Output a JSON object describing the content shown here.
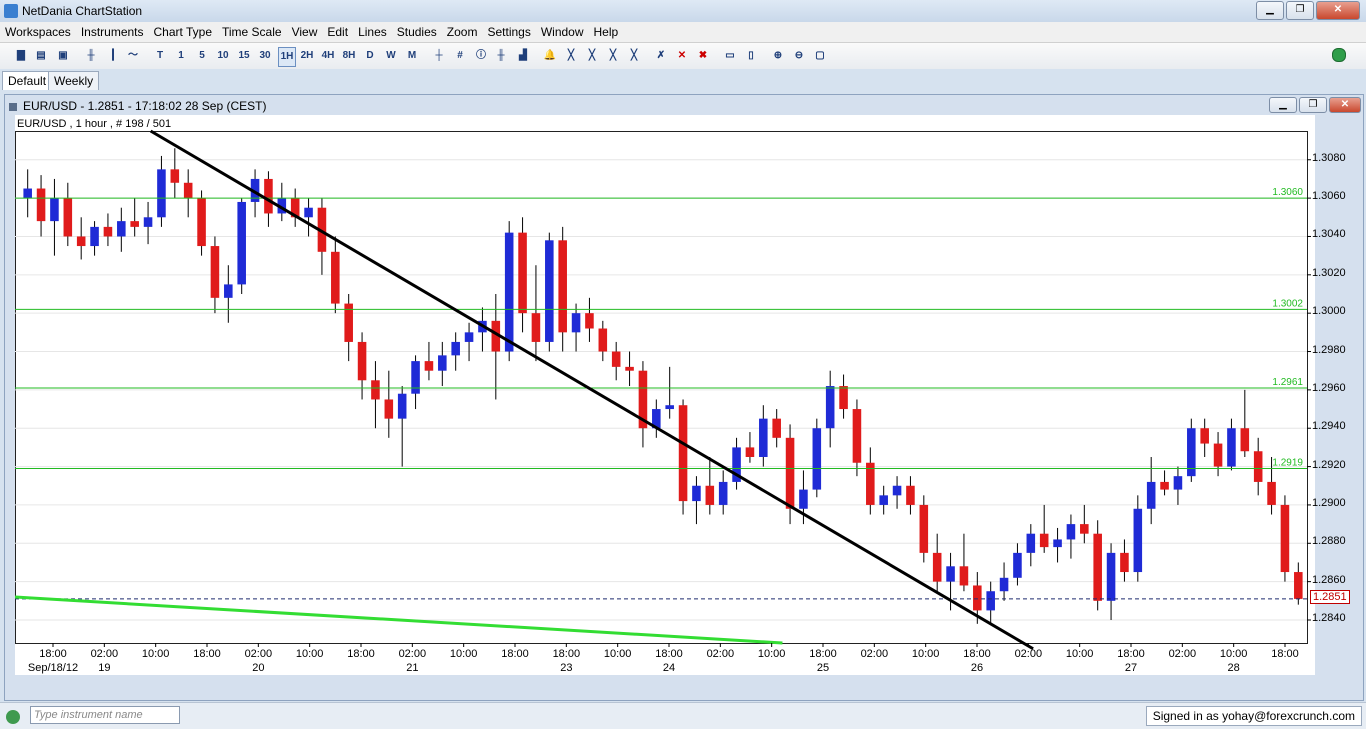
{
  "app": {
    "title": "NetDania ChartStation",
    "minimize": "▁",
    "maximize": "❐",
    "close": "✕"
  },
  "menu": [
    "Workspaces",
    "Instruments",
    "Chart Type",
    "Time Scale",
    "View",
    "Edit",
    "Lines",
    "Studies",
    "Zoom",
    "Settings",
    "Window",
    "Help"
  ],
  "toolbar": {
    "timeframes": [
      "T",
      "1",
      "5",
      "10",
      "15",
      "30",
      "1H",
      "2H",
      "4H",
      "8H",
      "D",
      "W",
      "M"
    ],
    "active_timeframe": "1H",
    "status_color": "#2f9e4a"
  },
  "tabs": [
    {
      "label": "Default",
      "active": true
    },
    {
      "label": "Weekly",
      "active": false
    }
  ],
  "chart_window": {
    "title": "EUR/USD - 1.2851 - 17:18:02  28 Sep (CEST)",
    "legend": "EUR/USD , 1 hour , # 198 / 501"
  },
  "chart_data": {
    "type": "candlestick",
    "instrument": "EUR/USD",
    "interval": "1 hour",
    "ylim": [
      1.2828,
      1.3095
    ],
    "y_ticks": [
      "1.3080",
      "1.3060",
      "1.3040",
      "1.3020",
      "1.3000",
      "1.2980",
      "1.2960",
      "1.2940",
      "1.2920",
      "1.2900",
      "1.2880",
      "1.2860",
      "1.2840"
    ],
    "y_tick_values": [
      1.308,
      1.306,
      1.304,
      1.302,
      1.3,
      1.298,
      1.296,
      1.294,
      1.292,
      1.29,
      1.288,
      1.286,
      1.284
    ],
    "x_time_labels": [
      "18:00",
      "02:00",
      "10:00",
      "18:00",
      "02:00",
      "10:00",
      "18:00",
      "02:00",
      "10:00",
      "18:00",
      "18:00",
      "10:00",
      "18:00",
      "02:00",
      "10:00",
      "18:00",
      "02:00",
      "10:00",
      "18:00",
      "02:00",
      "10:00",
      "18:00",
      "02:00",
      "10:00",
      "18:00"
    ],
    "x_date_labels": [
      "Sep/18/12",
      "19",
      "20",
      "21",
      "23",
      "24",
      "25",
      "26",
      "27",
      "28"
    ],
    "horizontal_lines": [
      {
        "label": "1.3060",
        "value": 1.306,
        "color": "#22bb22"
      },
      {
        "label": "1.3002",
        "value": 1.3002,
        "color": "#22bb22"
      },
      {
        "label": "1.2961",
        "value": 1.2961,
        "color": "#22bb22"
      },
      {
        "label": "1.2919",
        "value": 1.2919,
        "color": "#22bb22"
      }
    ],
    "current_price": {
      "label": "1.2851",
      "value": 1.2851,
      "color": "#c00000"
    },
    "trendlines": [
      {
        "color": "#000000",
        "from": [
          0.105,
          1.3095
        ],
        "to": [
          0.788,
          1.2825
        ]
      },
      {
        "color": "#33dd33",
        "from": [
          0.0,
          1.2852
        ],
        "to": [
          0.594,
          1.2828
        ]
      }
    ],
    "candles": [
      [
        1.306,
        1.3075,
        1.305,
        1.3065
      ],
      [
        1.3065,
        1.3072,
        1.304,
        1.3048
      ],
      [
        1.3048,
        1.307,
        1.303,
        1.306
      ],
      [
        1.306,
        1.3068,
        1.3035,
        1.304
      ],
      [
        1.304,
        1.305,
        1.3028,
        1.3035
      ],
      [
        1.3035,
        1.3048,
        1.303,
        1.3045
      ],
      [
        1.3045,
        1.3052,
        1.3035,
        1.304
      ],
      [
        1.304,
        1.3055,
        1.3032,
        1.3048
      ],
      [
        1.3048,
        1.306,
        1.304,
        1.3045
      ],
      [
        1.3045,
        1.3058,
        1.3036,
        1.305
      ],
      [
        1.305,
        1.3082,
        1.3045,
        1.3075
      ],
      [
        1.3075,
        1.3086,
        1.306,
        1.3068
      ],
      [
        1.3068,
        1.3075,
        1.305,
        1.306
      ],
      [
        1.306,
        1.3064,
        1.303,
        1.3035
      ],
      [
        1.3035,
        1.304,
        1.3,
        1.3008
      ],
      [
        1.3008,
        1.3025,
        1.2995,
        1.3015
      ],
      [
        1.3015,
        1.306,
        1.301,
        1.3058
      ],
      [
        1.3058,
        1.3075,
        1.305,
        1.307
      ],
      [
        1.307,
        1.3074,
        1.3045,
        1.3052
      ],
      [
        1.3052,
        1.3068,
        1.3048,
        1.306
      ],
      [
        1.306,
        1.3065,
        1.3045,
        1.305
      ],
      [
        1.305,
        1.306,
        1.304,
        1.3055
      ],
      [
        1.3055,
        1.306,
        1.302,
        1.3032
      ],
      [
        1.3032,
        1.304,
        1.3,
        1.3005
      ],
      [
        1.3005,
        1.301,
        1.2975,
        1.2985
      ],
      [
        1.2985,
        1.299,
        1.2955,
        1.2965
      ],
      [
        1.2965,
        1.2975,
        1.294,
        1.2955
      ],
      [
        1.2955,
        1.297,
        1.2935,
        1.2945
      ],
      [
        1.2945,
        1.2962,
        1.292,
        1.2958
      ],
      [
        1.2958,
        1.2978,
        1.295,
        1.2975
      ],
      [
        1.2975,
        1.2985,
        1.2965,
        1.297
      ],
      [
        1.297,
        1.2985,
        1.2962,
        1.2978
      ],
      [
        1.2978,
        1.299,
        1.297,
        1.2985
      ],
      [
        1.2985,
        1.2995,
        1.2975,
        1.299
      ],
      [
        1.299,
        1.3003,
        1.298,
        1.2996
      ],
      [
        1.2996,
        1.301,
        1.2955,
        1.298
      ],
      [
        1.298,
        1.3048,
        1.2975,
        1.3042
      ],
      [
        1.3042,
        1.305,
        1.299,
        1.3
      ],
      [
        1.3,
        1.3025,
        1.2975,
        1.2985
      ],
      [
        1.2985,
        1.3042,
        1.298,
        1.3038
      ],
      [
        1.3038,
        1.3045,
        1.298,
        1.299
      ],
      [
        1.299,
        1.3005,
        1.298,
        1.3
      ],
      [
        1.3,
        1.3008,
        1.2985,
        1.2992
      ],
      [
        1.2992,
        1.2996,
        1.2975,
        1.298
      ],
      [
        1.298,
        1.2985,
        1.2965,
        1.2972
      ],
      [
        1.2972,
        1.298,
        1.2962,
        1.297
      ],
      [
        1.297,
        1.2975,
        1.293,
        1.294
      ],
      [
        1.294,
        1.2955,
        1.2935,
        1.295
      ],
      [
        1.295,
        1.2972,
        1.2945,
        1.2952
      ],
      [
        1.2952,
        1.2955,
        1.2895,
        1.2902
      ],
      [
        1.2902,
        1.2915,
        1.289,
        1.291
      ],
      [
        1.291,
        1.2925,
        1.2895,
        1.29
      ],
      [
        1.29,
        1.2918,
        1.2895,
        1.2912
      ],
      [
        1.2912,
        1.2935,
        1.2908,
        1.293
      ],
      [
        1.293,
        1.2938,
        1.2922,
        1.2925
      ],
      [
        1.2925,
        1.2952,
        1.292,
        1.2945
      ],
      [
        1.2945,
        1.295,
        1.293,
        1.2935
      ],
      [
        1.2935,
        1.2942,
        1.289,
        1.2898
      ],
      [
        1.2898,
        1.2918,
        1.289,
        1.2908
      ],
      [
        1.2908,
        1.2945,
        1.2904,
        1.294
      ],
      [
        1.294,
        1.297,
        1.293,
        1.2962
      ],
      [
        1.2962,
        1.2968,
        1.2945,
        1.295
      ],
      [
        1.295,
        1.2955,
        1.2915,
        1.2922
      ],
      [
        1.2922,
        1.293,
        1.2895,
        1.29
      ],
      [
        1.29,
        1.291,
        1.2895,
        1.2905
      ],
      [
        1.2905,
        1.2915,
        1.2898,
        1.291
      ],
      [
        1.291,
        1.2915,
        1.2895,
        1.29
      ],
      [
        1.29,
        1.2905,
        1.287,
        1.2875
      ],
      [
        1.2875,
        1.2885,
        1.2855,
        1.286
      ],
      [
        1.286,
        1.2875,
        1.2845,
        1.2868
      ],
      [
        1.2868,
        1.2885,
        1.2855,
        1.2858
      ],
      [
        1.2858,
        1.2865,
        1.2838,
        1.2845
      ],
      [
        1.2845,
        1.286,
        1.2838,
        1.2855
      ],
      [
        1.2855,
        1.287,
        1.285,
        1.2862
      ],
      [
        1.2862,
        1.288,
        1.2858,
        1.2875
      ],
      [
        1.2875,
        1.289,
        1.2868,
        1.2885
      ],
      [
        1.2885,
        1.29,
        1.2875,
        1.2878
      ],
      [
        1.2878,
        1.2888,
        1.287,
        1.2882
      ],
      [
        1.2882,
        1.2895,
        1.2872,
        1.289
      ],
      [
        1.289,
        1.29,
        1.288,
        1.2885
      ],
      [
        1.2885,
        1.2892,
        1.2845,
        1.285
      ],
      [
        1.285,
        1.288,
        1.284,
        1.2875
      ],
      [
        1.2875,
        1.2882,
        1.286,
        1.2865
      ],
      [
        1.2865,
        1.2905,
        1.286,
        1.2898
      ],
      [
        1.2898,
        1.2925,
        1.289,
        1.2912
      ],
      [
        1.2912,
        1.2918,
        1.2905,
        1.2908
      ],
      [
        1.2908,
        1.292,
        1.29,
        1.2915
      ],
      [
        1.2915,
        1.2945,
        1.2912,
        1.294
      ],
      [
        1.294,
        1.2945,
        1.2925,
        1.2932
      ],
      [
        1.2932,
        1.2938,
        1.2915,
        1.292
      ],
      [
        1.292,
        1.2945,
        1.2918,
        1.294
      ],
      [
        1.294,
        1.296,
        1.2925,
        1.2928
      ],
      [
        1.2928,
        1.2935,
        1.2905,
        1.2912
      ],
      [
        1.2912,
        1.2925,
        1.2895,
        1.29
      ],
      [
        1.29,
        1.2905,
        1.286,
        1.2865
      ],
      [
        1.2865,
        1.287,
        1.2848,
        1.2851
      ]
    ]
  },
  "bottom": {
    "search_placeholder": "Type instrument name",
    "signed_in": "Signed in as yohay@forexcrunch.com"
  }
}
